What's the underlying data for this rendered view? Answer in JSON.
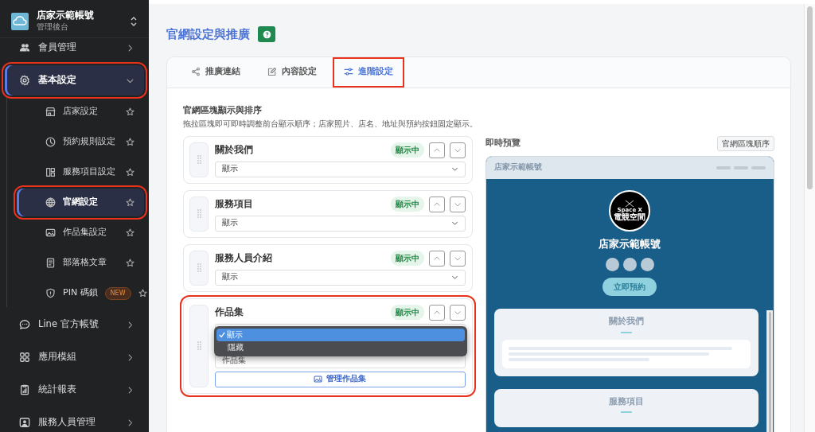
{
  "sidebar": {
    "brand": {
      "title": "店家示範帳號",
      "subtitle": "管理後台"
    },
    "items": [
      {
        "label": "會員管理",
        "kind": "users",
        "expanded": false,
        "selected": false,
        "highlighted": false
      },
      {
        "label": "基本設定",
        "kind": "gear",
        "expanded": true,
        "selected": true,
        "highlighted": true,
        "children": [
          {
            "label": "店家設定",
            "kind": "store",
            "selected": false,
            "highlighted": false
          },
          {
            "label": "預約規則設定",
            "kind": "clock",
            "selected": false,
            "highlighted": false
          },
          {
            "label": "服務項目設定",
            "kind": "layout",
            "selected": false,
            "highlighted": false
          },
          {
            "label": "官網設定",
            "kind": "globe",
            "selected": true,
            "highlighted": true
          },
          {
            "label": "作品集設定",
            "kind": "image",
            "selected": false,
            "highlighted": false
          },
          {
            "label": "部落格文章",
            "kind": "doc",
            "selected": false,
            "highlighted": false
          },
          {
            "label": "PIN 碼鎖",
            "kind": "shield",
            "badge": "NEW",
            "selected": false,
            "highlighted": false
          }
        ]
      },
      {
        "label": "Line 官方帳號",
        "kind": "chat",
        "expanded": false,
        "selected": false,
        "highlighted": false
      },
      {
        "label": "應用模組",
        "kind": "grid",
        "expanded": false,
        "selected": false,
        "highlighted": false
      },
      {
        "label": "統計報表",
        "kind": "report",
        "expanded": false,
        "selected": false,
        "highlighted": false
      },
      {
        "label": "服務人員管理",
        "kind": "person",
        "expanded": false,
        "selected": false,
        "highlighted": false
      }
    ]
  },
  "page": {
    "title": "官網設定與推廣",
    "tabs": [
      {
        "label": "推廣連結",
        "kind": "share",
        "selected": false,
        "highlighted": false
      },
      {
        "label": "內容設定",
        "kind": "edit",
        "selected": false,
        "highlighted": false
      },
      {
        "label": "進階設定",
        "kind": "sliders",
        "selected": true,
        "highlighted": true
      }
    ],
    "section": {
      "title": "官網區塊顯示與排序",
      "description": "拖拉區塊即可即時調整前台顯示順序；店家照片、店名、地址與預約按鈕固定顯示。"
    },
    "blocks": [
      {
        "title": "關於我們",
        "status": "顯示中",
        "select": {
          "value": "顯示",
          "open": false
        },
        "highlighted": false
      },
      {
        "title": "服務項目",
        "status": "顯示中",
        "select": {
          "value": "顯示",
          "open": false
        },
        "highlighted": false
      },
      {
        "title": "服務人員介紹",
        "status": "顯示中",
        "select": {
          "value": "顯示",
          "open": false
        },
        "highlighted": false
      },
      {
        "title": "作品集",
        "status": "顯示中",
        "select": {
          "open": true,
          "options": [
            {
              "label": "顯示",
              "selected": true
            },
            {
              "label": "隱藏",
              "selected": false
            }
          ]
        },
        "field_value": "作品集",
        "button": "管理作品集",
        "highlighted": true
      }
    ],
    "preview": {
      "heading": "即時預覽",
      "order_button": "官網區塊順序",
      "site": {
        "header_title": "店家示範帳號",
        "logo_lines": [
          "Space X",
          "電競空間"
        ],
        "name": "店家示範帳號",
        "cta": "立即預約",
        "sections": [
          "關於我們",
          "服務項目"
        ]
      }
    }
  }
}
